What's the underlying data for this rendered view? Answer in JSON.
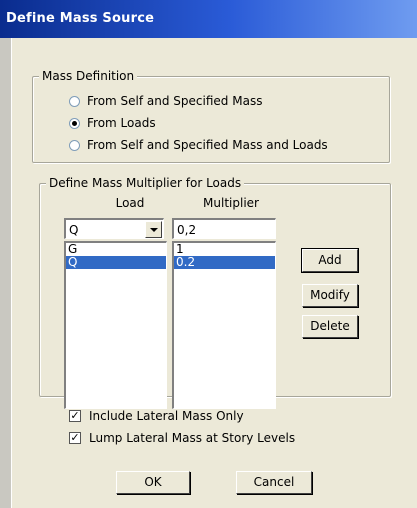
{
  "window": {
    "title": "Define Mass Source"
  },
  "mass_definition": {
    "legend": "Mass Definition",
    "options": [
      {
        "label": "From Self and Specified Mass",
        "checked": false
      },
      {
        "label": "From Loads",
        "checked": true
      },
      {
        "label": "From Self and Specified Mass and Loads",
        "checked": false
      }
    ]
  },
  "multiplier_group": {
    "legend": "Define Mass Multiplier for Loads",
    "load_header": "Load",
    "multiplier_header": "Multiplier",
    "load_select_value": "Q",
    "multiplier_input_value": "0,2",
    "load_items": [
      {
        "label": "G",
        "selected": false
      },
      {
        "label": "Q",
        "selected": true
      }
    ],
    "multiplier_items": [
      {
        "label": "1",
        "selected": false
      },
      {
        "label": "0.2",
        "selected": true
      }
    ],
    "buttons": {
      "add": "Add",
      "modify": "Modify",
      "delete": "Delete"
    }
  },
  "options": {
    "include_lateral": {
      "label": "Include Lateral Mass Only",
      "checked": true
    },
    "lump_lateral": {
      "label": "Lump Lateral Mass at Story Levels",
      "checked": true
    }
  },
  "footer": {
    "ok": "OK",
    "cancel": "Cancel"
  }
}
